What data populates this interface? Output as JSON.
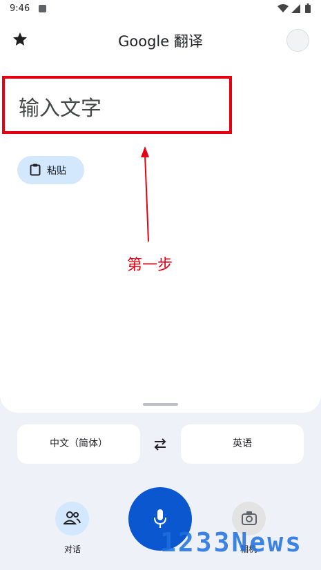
{
  "status": {
    "time": "9:46"
  },
  "header": {
    "title": "Google 翻译"
  },
  "input": {
    "placeholder": "输入文字"
  },
  "paste": {
    "label": "粘贴"
  },
  "annotation": {
    "step": "第一步"
  },
  "languages": {
    "source": "中文（简体）",
    "target": "英语"
  },
  "bottom": {
    "conversation_label": "对话",
    "camera_label": "相机"
  },
  "watermark": {
    "text": "1233News"
  },
  "colors": {
    "accent": "#0b57d0",
    "annotation": "#e60012",
    "chip": "#d3e7fd"
  }
}
